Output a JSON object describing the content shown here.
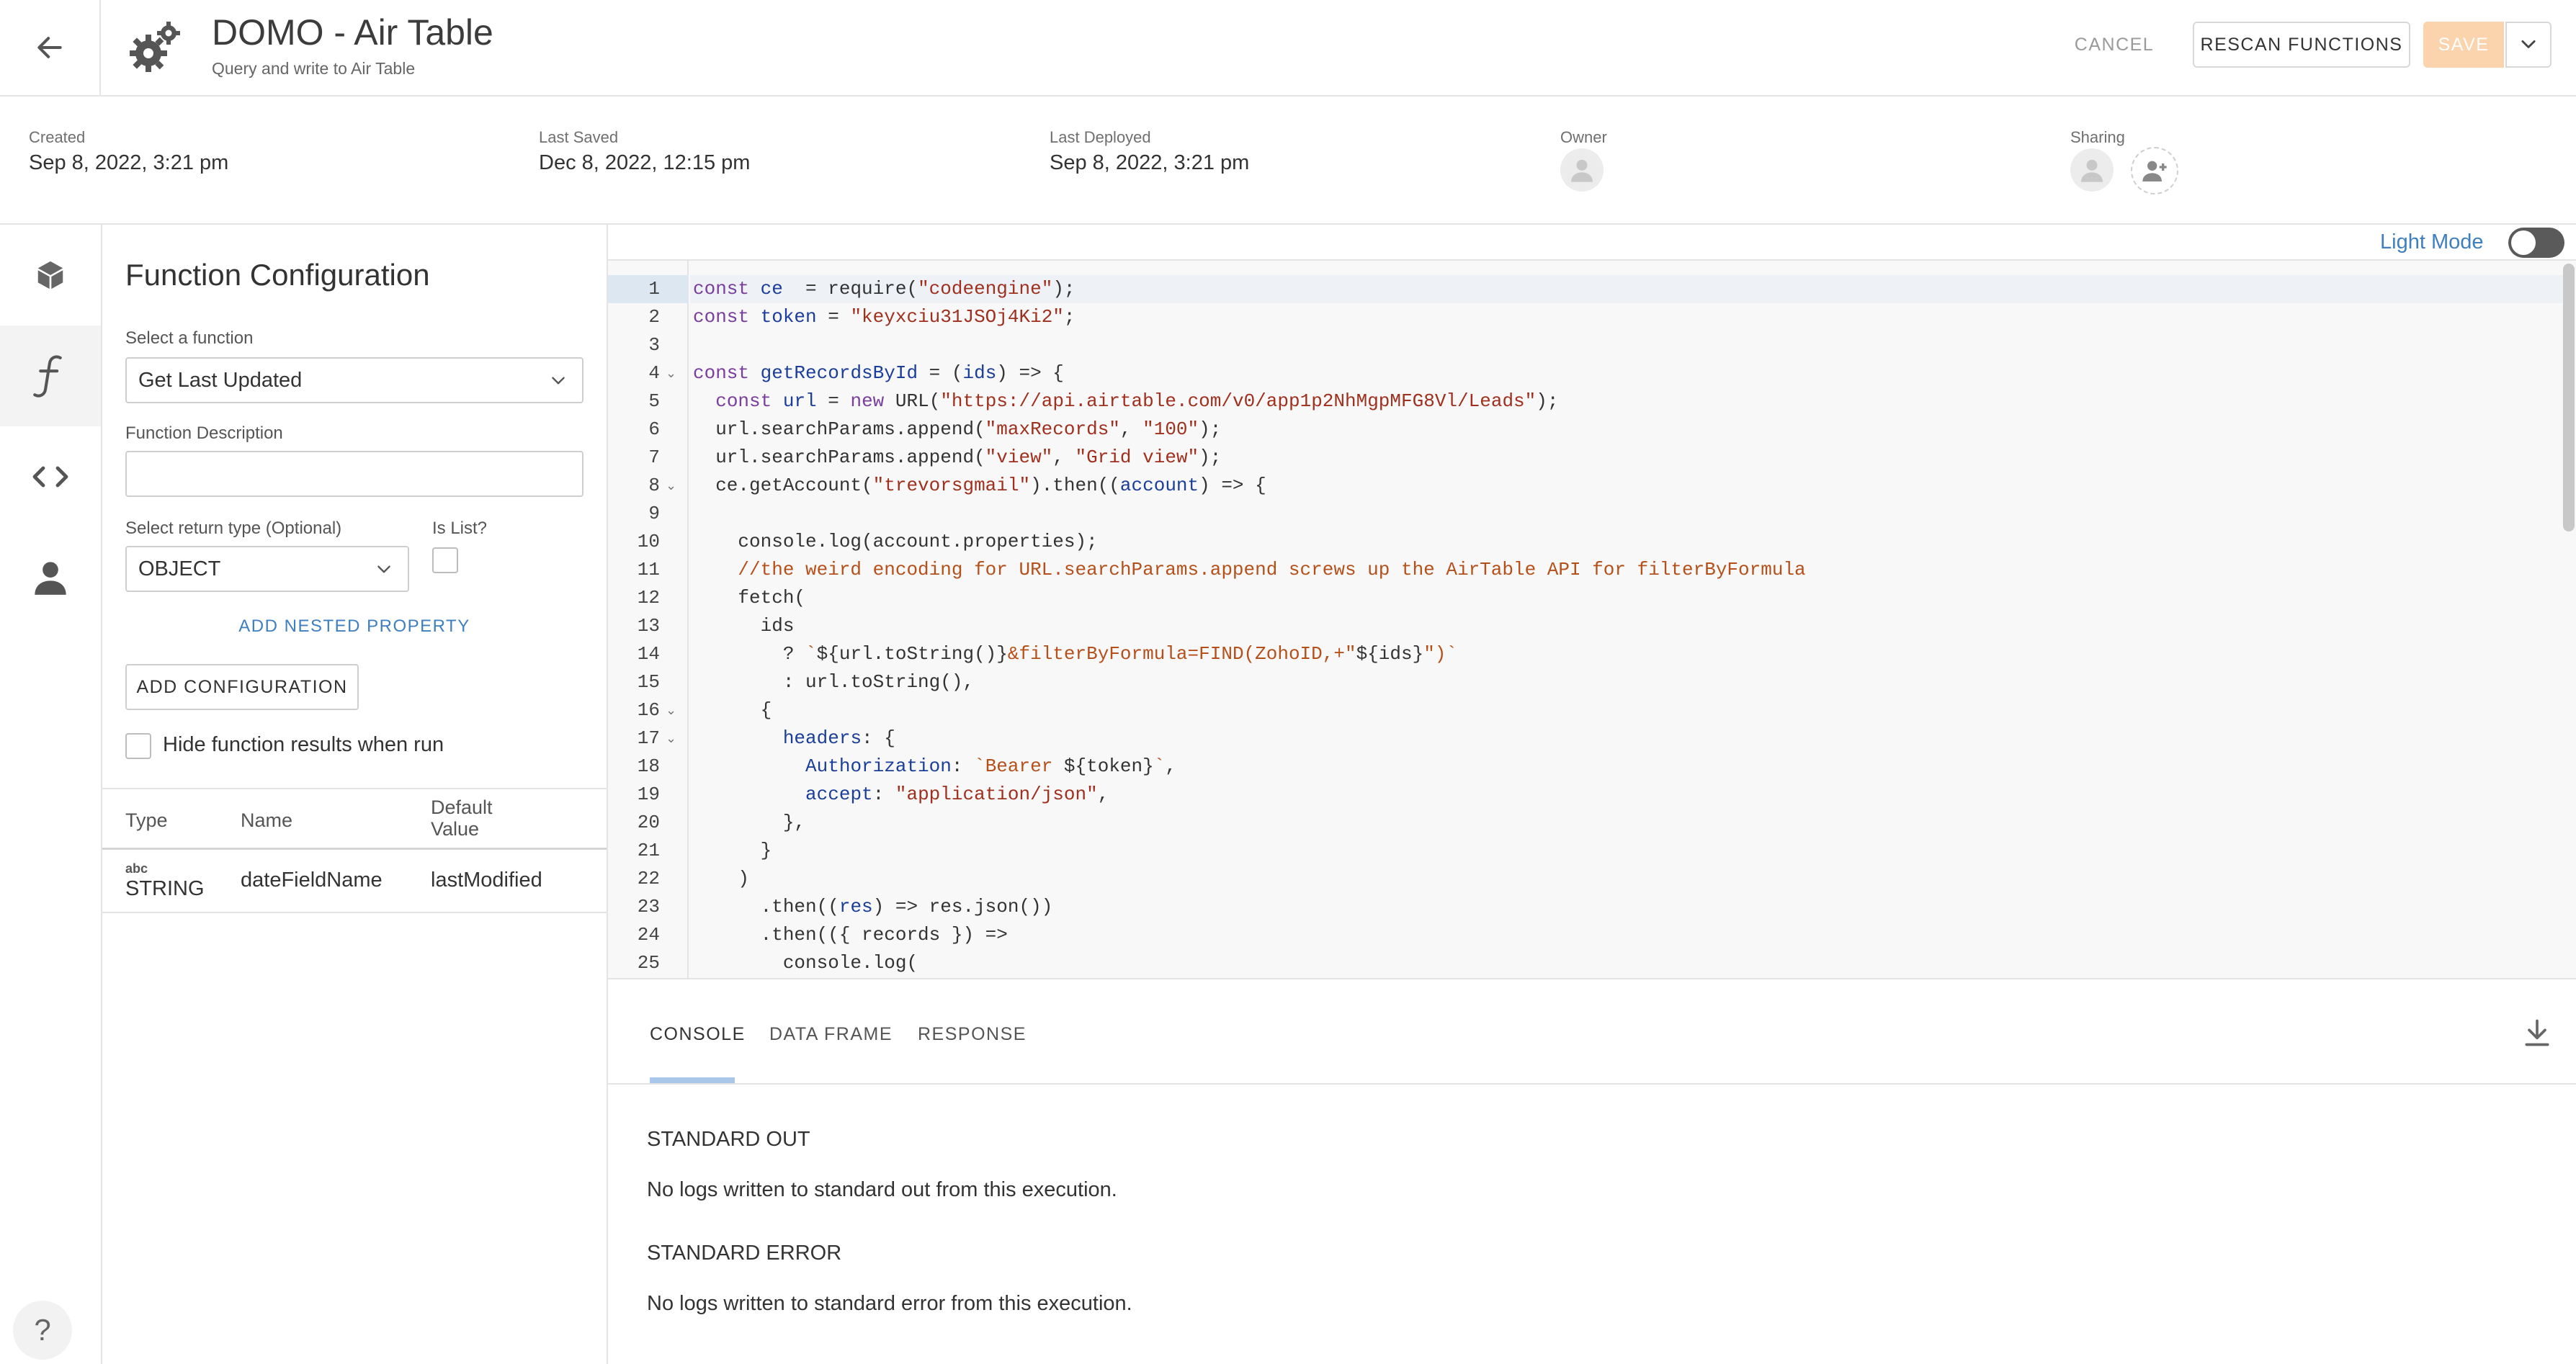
{
  "header": {
    "title": "DOMO - Air Table",
    "subtitle": "Query and write to Air Table",
    "cancel_label": "CANCEL",
    "rescan_label": "RESCAN FUNCTIONS",
    "save_label": "SAVE"
  },
  "meta": {
    "created_label": "Created",
    "created_value": "Sep 8, 2022, 3:21 pm",
    "last_saved_label": "Last Saved",
    "last_saved_value": "Dec 8, 2022, 12:15 pm",
    "last_deployed_label": "Last Deployed",
    "last_deployed_value": "Sep 8, 2022, 3:21 pm",
    "owner_label": "Owner",
    "sharing_label": "Sharing"
  },
  "config": {
    "title": "Function Configuration",
    "select_function_label": "Select a function",
    "selected_function": "Get Last Updated",
    "description_label": "Function Description",
    "description_value": "",
    "return_type_label": "Select return type (Optional)",
    "return_type_value": "OBJECT",
    "is_list_label": "Is List?",
    "add_nested_label": "ADD NESTED PROPERTY",
    "add_config_label": "ADD CONFIGURATION",
    "hide_results_label": "Hide function results when run",
    "table": {
      "headers": [
        "Type",
        "Name",
        "Default Value"
      ],
      "rows": [
        {
          "type_icon": "abc",
          "type": "STRING",
          "name": "dateFieldName",
          "default": "lastModified"
        }
      ]
    }
  },
  "editor": {
    "light_mode_label": "Light Mode",
    "light_mode_on": false,
    "line_numbers": [
      "1",
      "2",
      "3",
      "4",
      "5",
      "6",
      "7",
      "8",
      "9",
      "10",
      "11",
      "12",
      "13",
      "14",
      "15",
      "16",
      "17",
      "18",
      "19",
      "20",
      "21",
      "22",
      "23",
      "24",
      "25"
    ],
    "fold_markers": [
      "4",
      "8",
      "16",
      "17"
    ]
  },
  "console": {
    "tabs": [
      "CONSOLE",
      "DATA FRAME",
      "RESPONSE"
    ],
    "active_tab": "CONSOLE",
    "stdout_title": "STANDARD OUT",
    "stdout_msg": "No logs written to standard out from this execution.",
    "stderr_title": "STANDARD ERROR",
    "stderr_msg": "No logs written to standard error from this execution."
  },
  "icons": {
    "back": "arrow-left-icon",
    "app": "gears-icon",
    "rail": [
      "package-icon",
      "function-icon",
      "code-icon",
      "person-icon"
    ],
    "help": "question-icon",
    "download": "download-icon"
  },
  "colors": {
    "accent_blue": "#3f7fbf",
    "save_disabled": "#fbd3ad",
    "active_line": "#dde7f2",
    "tab_underline": "#a9c7e8"
  }
}
